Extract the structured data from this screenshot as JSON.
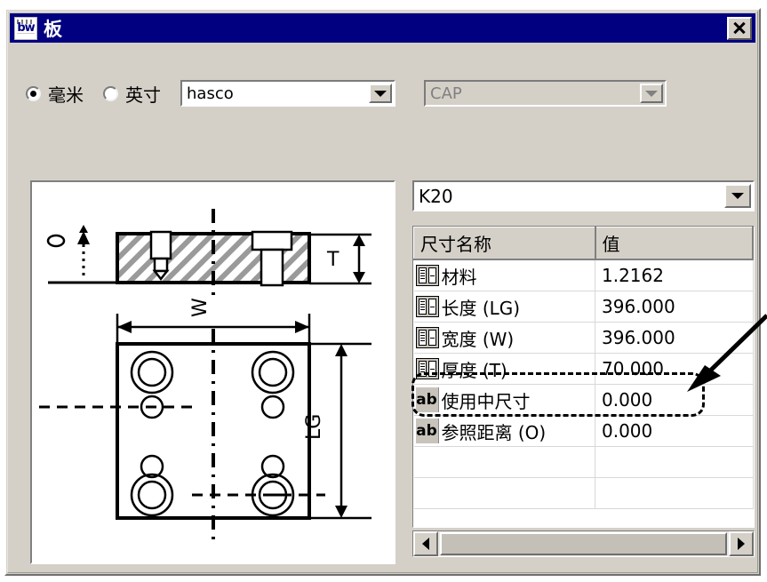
{
  "window": {
    "title": "板",
    "icon": "bw-logo-icon",
    "close_label": "✕"
  },
  "units": {
    "options": [
      {
        "label": "毫米",
        "selected": true,
        "name": "radio-millimeter"
      },
      {
        "label": "英寸",
        "selected": false,
        "name": "radio-inch"
      }
    ]
  },
  "combos": {
    "vendor": {
      "value": "hasco",
      "disabled": false
    },
    "cap": {
      "value": "CAP",
      "disabled": true
    },
    "part": {
      "value": "K20",
      "disabled": false
    }
  },
  "grid": {
    "headers": [
      "尺寸名称",
      "值"
    ],
    "rows": [
      {
        "icon": "list-type-icon",
        "icon_label": "",
        "name": "材料",
        "value": "1.2162"
      },
      {
        "icon": "list-type-icon",
        "icon_label": "",
        "name": "长度 (LG)",
        "value": "396.000"
      },
      {
        "icon": "list-type-icon",
        "icon_label": "",
        "name": "宽度 (W)",
        "value": "396.000"
      },
      {
        "icon": "list-type-icon",
        "icon_label": "",
        "name": "厚度 (T)",
        "value": "70.000"
      },
      {
        "icon": "text-type-icon",
        "icon_label": "ab",
        "name": "使用中尺寸",
        "value": "0.000"
      },
      {
        "icon": "text-type-icon",
        "icon_label": "ab",
        "name": "参照距离 (O)",
        "value": "0.000"
      }
    ],
    "empty_rows": 2
  },
  "drawing": {
    "labels": {
      "thickness": "T",
      "width": "W",
      "length": "LG"
    }
  },
  "annotation": {
    "highlight_row": "厚度 (T)",
    "arrow": "callout-arrow"
  },
  "colors": {
    "titlebar": "#000080",
    "dialog_face": "#d4d0c8",
    "field_bg": "#ffffff",
    "disabled_text": "#808080"
  }
}
